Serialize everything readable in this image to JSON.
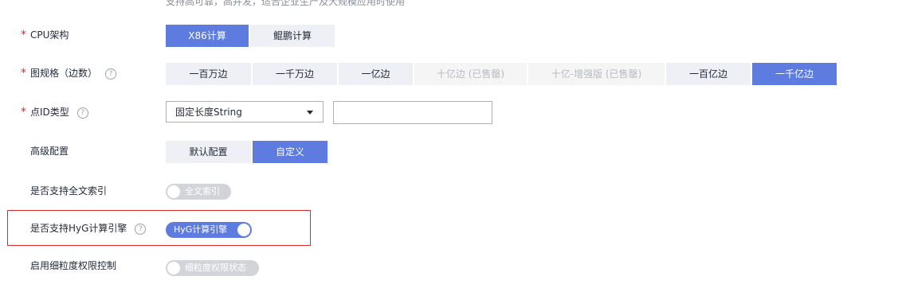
{
  "header": {
    "note": "支持高可靠，高并发，适合企业生产及大规模应用时使用"
  },
  "cpu": {
    "label": "CPU架构",
    "required_mark": "*",
    "options": [
      "X86计算",
      "鲲鹏计算"
    ],
    "selected": "X86计算"
  },
  "graph_size": {
    "label": "图规格（边数）",
    "required_mark": "*",
    "help": "?",
    "options": [
      "一百万边",
      "一千万边",
      "一亿边",
      "十亿边 (已售罄)",
      "十亿-增强版 (已售罄)",
      "一百亿边",
      "一千亿边"
    ],
    "disabled": [
      "十亿边 (已售罄)",
      "十亿-增强版 (已售罄)"
    ],
    "selected": "一千亿边"
  },
  "vertex_id": {
    "label": "点ID类型",
    "required_mark": "*",
    "help": "?",
    "select_value": "固定长度String",
    "length_value": ""
  },
  "advanced": {
    "label": "高级配置",
    "options": [
      "默认配置",
      "自定义"
    ],
    "selected": "自定义"
  },
  "fulltext": {
    "label": "是否支持全文索引",
    "switch_text": "全文索引",
    "on": false
  },
  "hyg": {
    "label": "是否支持HyG计算引擎",
    "help": "?",
    "switch_text": "HyG计算引擎",
    "on": true
  },
  "acl": {
    "label": "启用细粒度权限控制",
    "switch_text": "细粒度权限状态",
    "on": false
  },
  "colors": {
    "accent": "#5e7ce0",
    "required": "#f5222d",
    "highlight_border": "#e02828"
  }
}
